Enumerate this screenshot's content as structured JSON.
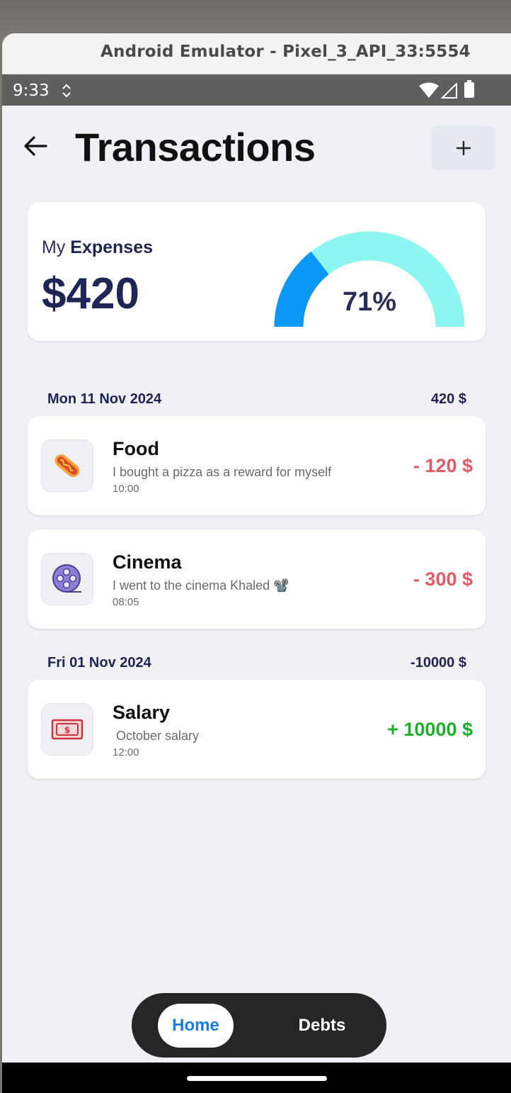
{
  "window": {
    "title": "Android Emulator - Pixel_3_API_33:5554"
  },
  "status_bar": {
    "time": "9:33"
  },
  "app_bar": {
    "title": "Transactions",
    "back_icon": "arrow-left-icon",
    "add_icon": "plus-icon"
  },
  "summary": {
    "label_prefix": "My",
    "label_bold": "Expenses",
    "amount": "$420",
    "gauge_percent_text": "71%",
    "gauge_fraction": 0.29,
    "colors": {
      "primary": "#0a97f5",
      "secondary": "#8ef6f0",
      "track": "#f0f1f5"
    }
  },
  "groups": [
    {
      "date": "Mon 11 Nov 2024",
      "total": "420 $",
      "transactions": [
        {
          "title": "Food",
          "description": "I bought a pizza as a reward for myself",
          "time": "10:00",
          "amount": "- 120 $",
          "icon": "hotdog-icon"
        },
        {
          "title": "Cinema",
          "description": "I went to the cinema  Khaled 📽️",
          "time": "08:05",
          "amount": "- 300 $",
          "icon": "film-reel-icon"
        }
      ]
    },
    {
      "date": "Fri 01 Nov 2024",
      "total": "-10000 $",
      "transactions": [
        {
          "title": "Salary",
          "description": " October salary",
          "time": "12:00",
          "amount": "+ 10000 $",
          "icon": "banknote-icon"
        }
      ]
    }
  ],
  "bottom_nav": {
    "home": "Home",
    "debts": "Debts",
    "active": "Home"
  }
}
